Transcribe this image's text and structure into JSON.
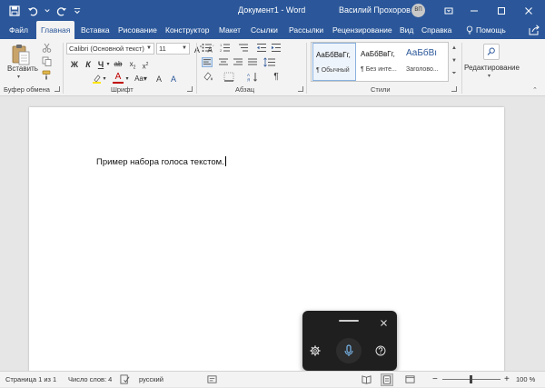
{
  "title_bar": {
    "document_title": "Документ1  -  Word",
    "user_name": "Василий Прохоров",
    "user_initials": "ВП"
  },
  "tabs": [
    {
      "label": "Файл",
      "active": false
    },
    {
      "label": "Главная",
      "active": true
    },
    {
      "label": "Вставка",
      "active": false
    },
    {
      "label": "Рисование",
      "active": false
    },
    {
      "label": "Конструктор",
      "active": false
    },
    {
      "label": "Макет",
      "active": false
    },
    {
      "label": "Ссылки",
      "active": false
    },
    {
      "label": "Рассылки",
      "active": false
    },
    {
      "label": "Рецензирование",
      "active": false
    },
    {
      "label": "Вид",
      "active": false
    },
    {
      "label": "Справка",
      "active": false
    }
  ],
  "help_label": "Помощь",
  "ribbon": {
    "clipboard": {
      "paste_label": "Вставить",
      "group_label": "Буфер обмена"
    },
    "font": {
      "font_name": "Calibri (Основной текст)",
      "font_size": "11",
      "bold": "Ж",
      "italic": "К",
      "underline": "Ч",
      "font_color_letter": "A",
      "group_label": "Шрифт"
    },
    "paragraph": {
      "group_label": "Абзац"
    },
    "styles": {
      "items": [
        {
          "preview": "АаБбВвГг,",
          "name": "¶ Обычный"
        },
        {
          "preview": "АаБбВвГг,",
          "name": "¶ Без инте..."
        },
        {
          "preview": "АаБбВı",
          "name": "Заголово..."
        }
      ],
      "group_label": "Стили"
    },
    "editing": {
      "label": "Редактирование"
    }
  },
  "document": {
    "text": "Пример набора голоса текстом."
  },
  "status_bar": {
    "page": "Страница 1 из 1",
    "word_count": "Число слов: 4",
    "language": "русский",
    "zoom": "100 %"
  },
  "colors": {
    "accent": "#2b579a",
    "ribbon_bg": "#f3f3f3",
    "voice_panel_bg": "#1f1f1f"
  }
}
